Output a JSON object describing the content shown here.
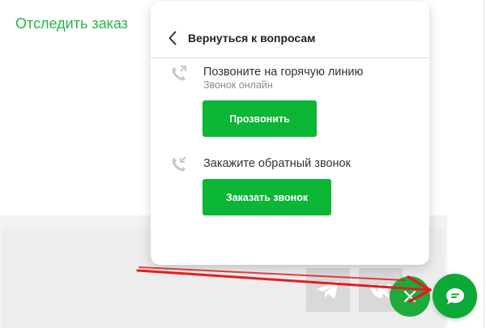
{
  "page": {
    "track_order_link": "Отследить заказ"
  },
  "popup": {
    "back_label": "Вернуться к вопросам",
    "hotline": {
      "title": "Позвоните на горячую линию",
      "subtitle": "Звонок онлайн",
      "button": "Прозвонить",
      "icon": "phone-call-icon"
    },
    "callback": {
      "title": "Закажите обратный звонок",
      "button": "Заказать звонок",
      "icon": "phone-callback-icon"
    }
  },
  "widgets": {
    "social_icons": [
      "telegram-icon",
      "vk-icon"
    ],
    "close_icon": "close-icon",
    "chat_icon": "chat-bubble-icon"
  },
  "colors": {
    "accent_green": "#0ab634",
    "link_green": "#29b34a",
    "annotation_red": "#e02020"
  }
}
